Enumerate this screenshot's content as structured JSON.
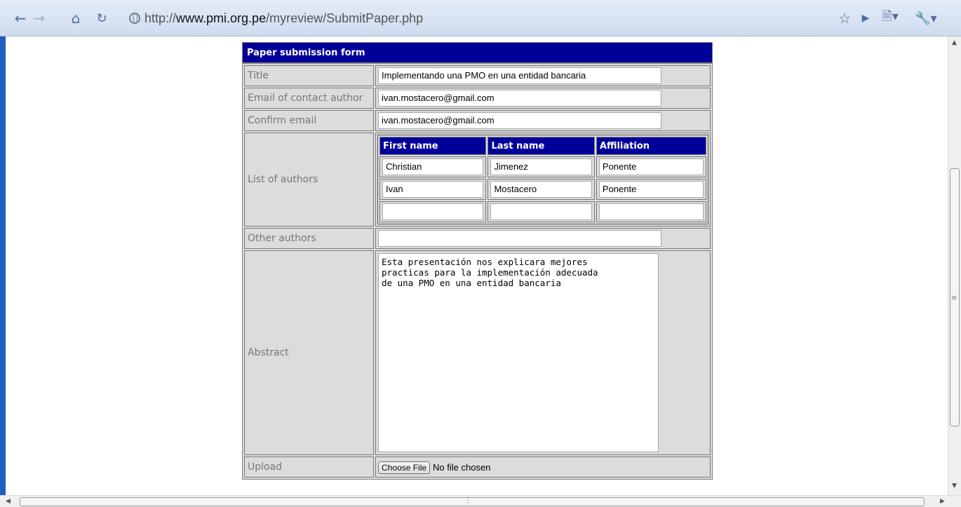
{
  "browser": {
    "url_prefix": "http://",
    "url_domain": "www.pmi.org.pe",
    "url_path": "/myreview/SubmitPaper.php"
  },
  "form": {
    "header": "Paper submission form",
    "title_label": "Title",
    "title_value": "Implementando una PMO en una entidad bancaria",
    "email_label": "Email of contact author",
    "email_value": "ivan.mostacero@gmail.com",
    "confirm_label": "Confirm email",
    "confirm_value": "ivan.mostacero@gmail.com",
    "authors_label": "List of authors",
    "authors_columns": {
      "first": "First name",
      "last": "Last name",
      "affiliation": "Affiliation"
    },
    "authors": [
      {
        "first": "Christian",
        "last": "Jimenez",
        "affiliation": "Ponente"
      },
      {
        "first": "Ivan",
        "last": "Mostacero",
        "affiliation": "Ponente"
      },
      {
        "first": "",
        "last": "",
        "affiliation": ""
      }
    ],
    "other_label": "Other authors",
    "other_value": "",
    "abstract_label": "Abstract",
    "abstract_value": "Esta presentación nos explicara mejores\npracticas para la implementación adecuada\nde una PMO en una entidad bancaria",
    "upload_label": "Upload",
    "choose_file": "Choose File",
    "no_file": "No file chosen"
  },
  "icons": {
    "back": "back-arrow-icon",
    "forward": "forward-arrow-icon",
    "home": "home-icon",
    "reload": "reload-icon",
    "globe": "globe-icon",
    "star": "star-icon",
    "play": "play-icon",
    "page": "page-menu-icon",
    "wrench": "wrench-icon"
  }
}
